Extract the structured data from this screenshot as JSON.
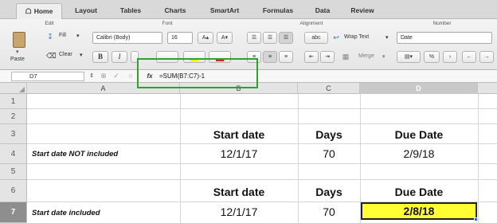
{
  "ribbon_tabs": [
    "Home",
    "Layout",
    "Tables",
    "Charts",
    "SmartArt",
    "Formulas",
    "Data",
    "Review"
  ],
  "ribbon": {
    "groups": {
      "edit": "Edit",
      "font": "Font",
      "alignment": "Alignment",
      "number": "Number"
    },
    "paste_label": "Paste",
    "fill_label": "Fill",
    "clear_label": "Clear",
    "font_name": "Calibri (Body)",
    "font_size": "16",
    "bold": "B",
    "italic": "I",
    "font_grow": "A▴",
    "font_shrink": "A▾",
    "abc_label": "abc",
    "wrap_text_label": "Wrap Text",
    "merge_label": "Merge",
    "number_format": "Date",
    "percent_label": "%",
    "comma_label": "›"
  },
  "formula_bar": {
    "cell_ref": "D7",
    "fx": "fx",
    "formula": "=SUM(B7:C7)-1"
  },
  "sheet": {
    "columns": [
      "A",
      "B",
      "C",
      "D"
    ],
    "rows": [
      "1",
      "2",
      "3",
      "4",
      "5",
      "6",
      "7"
    ],
    "selected_cell": "D7",
    "cells": {
      "B3": "Start date",
      "C3": "Days",
      "D3": "Due Date",
      "A4": "Start date NOT included",
      "B4": "12/1/17",
      "C4": "70",
      "D4": "2/9/18",
      "B6": "Start date",
      "C6": "Days",
      "D6": "Due Date",
      "A7": "Start date included",
      "B7": "12/1/17",
      "C7": "70",
      "D7": "2/8/18"
    }
  },
  "colors": {
    "selection_fill": "#ffff33",
    "callout_border": "#2da22d"
  }
}
